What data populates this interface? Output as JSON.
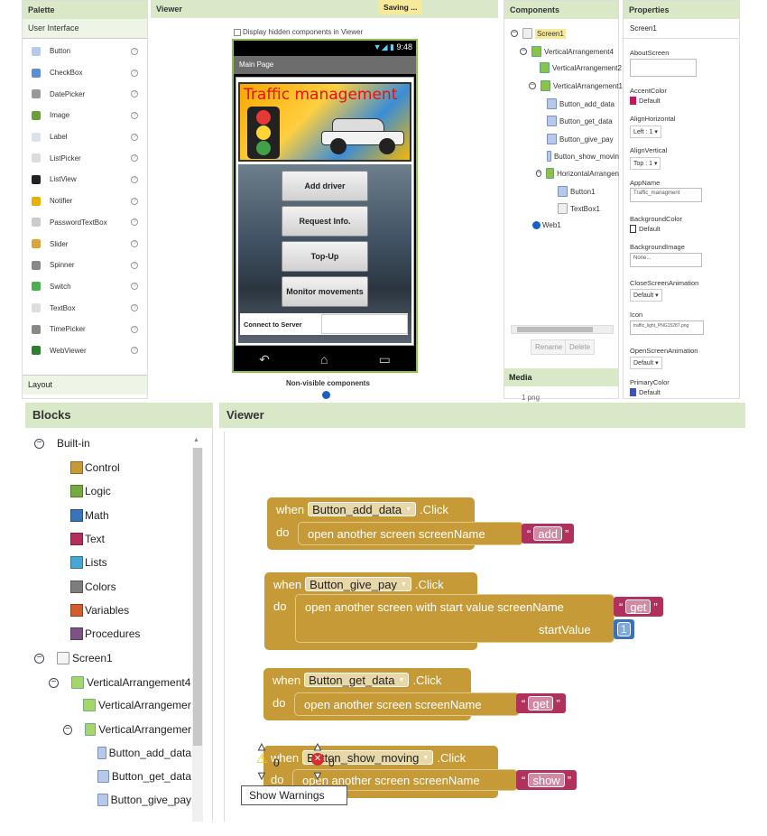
{
  "designer": {
    "palette": {
      "header": "Palette",
      "section": "User Interface",
      "items": [
        {
          "label": "Button",
          "icon": "button-icon",
          "color": "#b8c8e8"
        },
        {
          "label": "CheckBox",
          "icon": "checkbox-icon",
          "color": "#5b8fd4"
        },
        {
          "label": "DatePicker",
          "icon": "calendar-icon",
          "color": "#999999"
        },
        {
          "label": "Image",
          "icon": "image-icon",
          "color": "#6a9f3a"
        },
        {
          "label": "Label",
          "icon": "label-icon",
          "color": "#dde3ee"
        },
        {
          "label": "ListPicker",
          "icon": "list-picker-icon",
          "color": "#dddddd"
        },
        {
          "label": "ListView",
          "icon": "list-view-icon",
          "color": "#222222"
        },
        {
          "label": "Notifier",
          "icon": "warning-icon",
          "color": "#e8b000"
        },
        {
          "label": "PasswordTextBox",
          "icon": "password-icon",
          "color": "#cccccc"
        },
        {
          "label": "Slider",
          "icon": "slider-icon",
          "color": "#d9a53a"
        },
        {
          "label": "Spinner",
          "icon": "spinner-icon",
          "color": "#888888"
        },
        {
          "label": "Switch",
          "icon": "switch-icon",
          "color": "#4caf50"
        },
        {
          "label": "TextBox",
          "icon": "textbox-icon",
          "color": "#dddddd"
        },
        {
          "label": "TimePicker",
          "icon": "clock-icon",
          "color": "#888888"
        },
        {
          "label": "WebViewer",
          "icon": "globe-icon",
          "color": "#2e7d32"
        }
      ],
      "layout_section": "Layout"
    },
    "viewer": {
      "header": "Viewer",
      "saving": "Saving ...",
      "checkbox_label": "Display hidden components in Viewer",
      "status_time": "9:48",
      "app_title": "Main Page",
      "banner_title": "Traffic management",
      "buttons": [
        "Add driver",
        "Request Info.",
        "Top-Up",
        "Monitor movements"
      ],
      "connect_label": "Connect to Server",
      "non_visible": "Non-visible components"
    },
    "components": {
      "header": "Components",
      "tree": [
        {
          "label": "Screen1",
          "kind": "screen"
        },
        {
          "label": "VerticalArrangement4",
          "kind": "arr"
        },
        {
          "label": "VerticalArrangement2",
          "kind": "arr"
        },
        {
          "label": "VerticalArrangement1",
          "kind": "arr"
        },
        {
          "label": "Button_add_data",
          "kind": "btn"
        },
        {
          "label": "Button_get_data",
          "kind": "btn"
        },
        {
          "label": "Button_give_pay",
          "kind": "btn"
        },
        {
          "label": "Button_show_movin",
          "kind": "btn"
        },
        {
          "label": "HorizontalArrangen",
          "kind": "arr"
        },
        {
          "label": "Button1",
          "kind": "btn"
        },
        {
          "label": "TextBox1",
          "kind": "txt"
        },
        {
          "label": "Web1",
          "kind": "web"
        }
      ],
      "rename": "Rename",
      "delete": "Delete",
      "media_header": "Media",
      "media_item": "1 png"
    },
    "properties": {
      "header": "Properties",
      "screen": "Screen1",
      "about_label": "AboutScreen",
      "accent_label": "AccentColor",
      "accent_value": "Default",
      "accent_color": "#c2185b",
      "align_h_label": "AlignHorizontal",
      "align_h_value": "Left : 1 ▾",
      "align_v_label": "AlignVertical",
      "align_v_value": "Top : 1 ▾",
      "appname_label": "AppName",
      "appname_value": "Traffic_managment",
      "bgcolor_label": "BackgroundColor",
      "bgcolor_value": "Default",
      "bgimage_label": "BackgroundImage",
      "bgimage_value": "None...",
      "close_anim_label": "CloseScreenAnimation",
      "close_anim_value": "Default ▾",
      "icon_label": "Icon",
      "icon_value": "traffic_light_PNG15287.png",
      "open_anim_label": "OpenScreenAnimation",
      "open_anim_value": "Default ▾",
      "primary_label": "PrimaryColor",
      "primary_value": "Default",
      "primary_color": "#3f51b5"
    }
  },
  "blocks_editor": {
    "blocks_header": "Blocks",
    "viewer_header": "Viewer",
    "builtin": "Built-in",
    "builtin_items": [
      {
        "label": "Control",
        "color": "#c69a36"
      },
      {
        "label": "Logic",
        "color": "#77ab41"
      },
      {
        "label": "Math",
        "color": "#3b73b8"
      },
      {
        "label": "Text",
        "color": "#b0315c"
      },
      {
        "label": "Lists",
        "color": "#49a6d4"
      },
      {
        "label": "Colors",
        "color": "#7d7d7d"
      },
      {
        "label": "Variables",
        "color": "#d05f2d"
      },
      {
        "label": "Procedures",
        "color": "#7c5385"
      }
    ],
    "screen_tree": [
      {
        "label": "Screen1"
      },
      {
        "label": "VerticalArrangement4"
      },
      {
        "label": "VerticalArrangemer"
      },
      {
        "label": "VerticalArrangemer"
      },
      {
        "label": "Button_add_data"
      },
      {
        "label": "Button_get_data"
      },
      {
        "label": "Button_give_pay"
      }
    ],
    "blocks": [
      {
        "when": "when",
        "component": "Button_add_data",
        "event": ".Click",
        "do": "do",
        "action": "open another screen  screenName",
        "value": "add"
      },
      {
        "when": "when",
        "component": "Button_give_pay",
        "event": ".Click",
        "do": "do",
        "action": "open another screen with start value  screenName",
        "value": "get",
        "start_label": "startValue",
        "start_value": "1"
      },
      {
        "when": "when",
        "component": "Button_get_data",
        "event": ".Click",
        "do": "do",
        "action": "open another screen  screenName",
        "value": "get"
      },
      {
        "when": "when",
        "component": "Button_show_moving",
        "event": ".Click",
        "do": "do",
        "action": "open another screen  screenName",
        "value": "show"
      }
    ],
    "warn_count": "0",
    "error_count": "0",
    "show_warnings": "Show Warnings"
  }
}
